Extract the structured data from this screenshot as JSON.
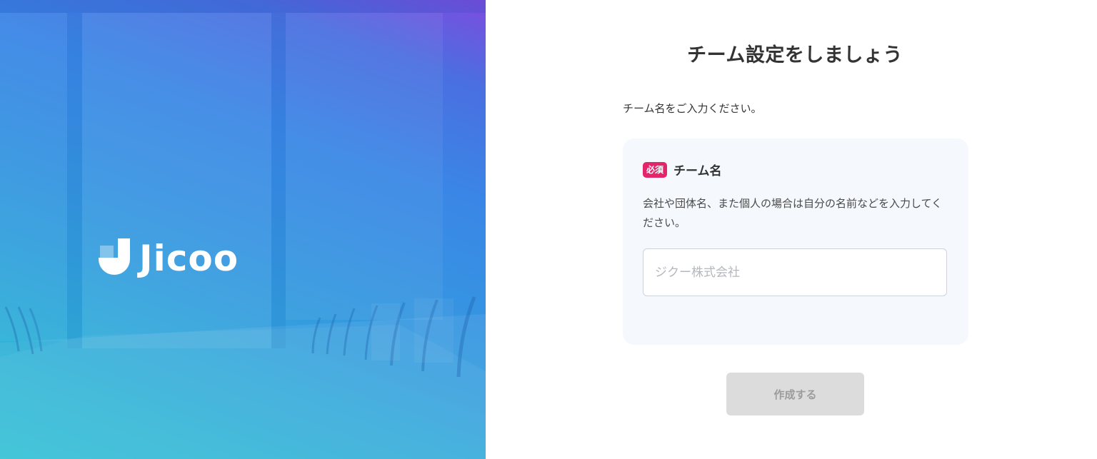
{
  "brand": {
    "logo_text": "Jicoo",
    "logo_icon": "jicoo-logo-icon"
  },
  "form": {
    "title": "チーム設定をしましょう",
    "subtitle": "チーム名をご入力ください。",
    "field": {
      "required_badge": "必須",
      "label": "チーム名",
      "help": "会社や団体名、また個人の場合は自分の名前などを入力してください。",
      "value": "",
      "placeholder": "ジクー株式会社"
    },
    "submit_label": "作成する",
    "submit_enabled": false
  },
  "colors": {
    "accent_required": "#e3256b",
    "button_disabled_bg": "#dcdcdc",
    "card_bg": "#f5f8fc",
    "hero_gradient_top": "#7d4ce0",
    "hero_gradient_bottom": "#2ec0d3"
  }
}
